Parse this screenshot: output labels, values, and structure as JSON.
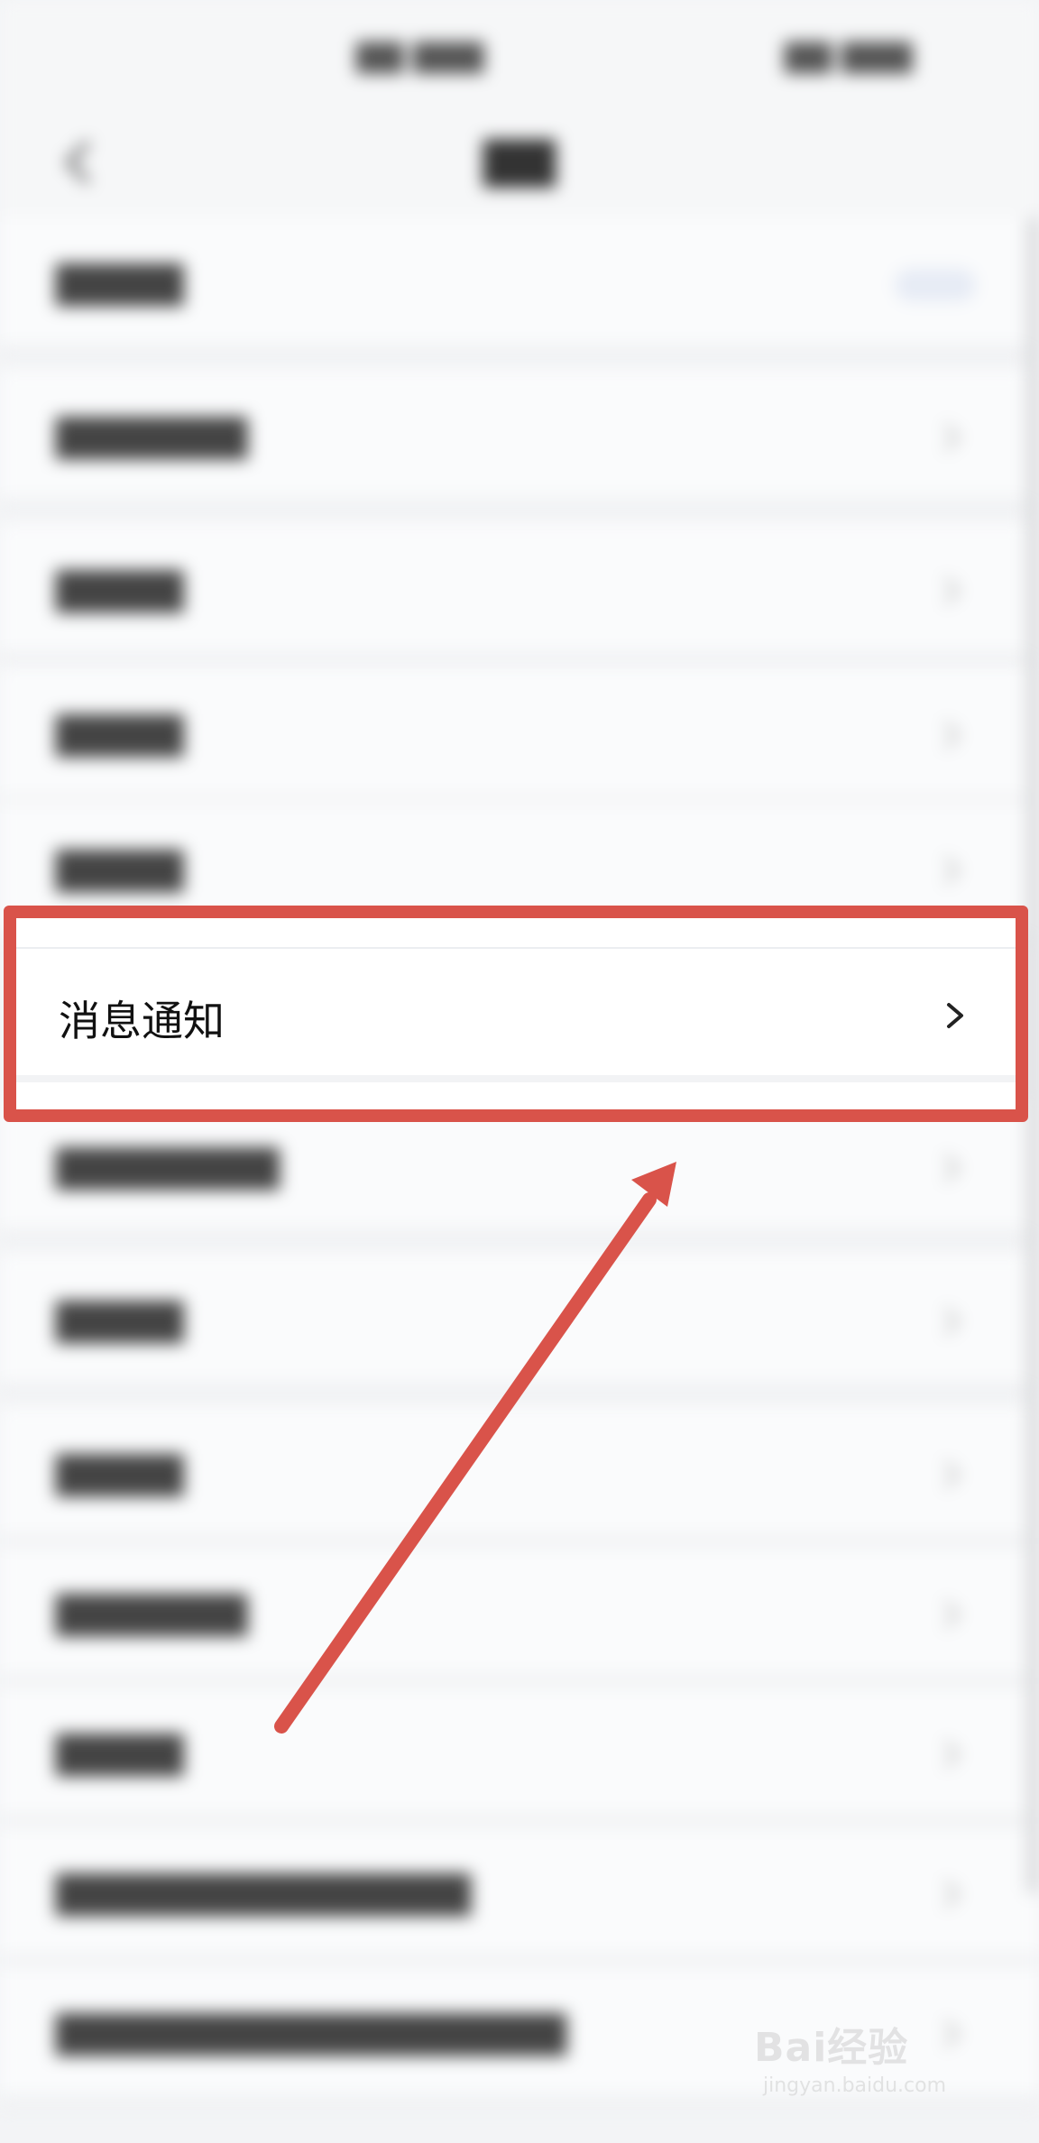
{
  "screen": {
    "highlighted_item": {
      "label": "消息通知",
      "chevron": "chevron-right-icon"
    },
    "background_rows": [
      {
        "icon": "chevron-right-icon"
      },
      {
        "icon": "chevron-right-icon"
      },
      {
        "icon": "chevron-right-icon"
      },
      {
        "icon": "chevron-right-icon"
      },
      {
        "icon": "chevron-right-icon"
      },
      {
        "icon": "chevron-right-icon"
      },
      {
        "icon": "chevron-right-icon"
      },
      {
        "icon": "chevron-right-icon"
      },
      {
        "icon": "chevron-right-icon"
      },
      {
        "icon": "chevron-right-icon"
      },
      {
        "icon": "chevron-right-icon"
      },
      {
        "icon": "chevron-right-icon"
      },
      {
        "icon": "chevron-right-icon"
      },
      {
        "icon": "chevron-right-icon"
      }
    ]
  },
  "annotation": {
    "highlight_color": "#d9534a",
    "arrow_color": "#d9534a"
  },
  "watermark": {
    "logo_text": "Bai经验",
    "url": "jingyan.baidu.com"
  }
}
